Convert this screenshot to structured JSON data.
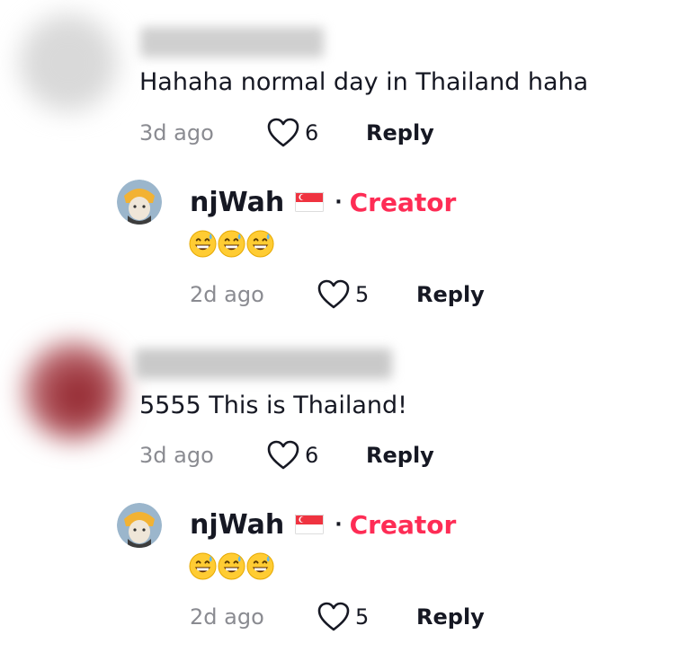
{
  "comments": [
    {
      "text": "Hahaha normal day in Thailand haha",
      "time": "3d ago",
      "likes": "6",
      "reply_label": "Reply",
      "reply": {
        "username": "njWah",
        "badge": "Creator",
        "separator": "·",
        "emoji_count": 3,
        "time": "2d ago",
        "likes": "5",
        "reply_label": "Reply"
      }
    },
    {
      "text": "5555 This is Thailand!",
      "time": "3d ago",
      "likes": "6",
      "reply_label": "Reply",
      "reply": {
        "username": "njWah",
        "badge": "Creator",
        "separator": "·",
        "emoji_count": 3,
        "time": "2d ago",
        "likes": "5",
        "reply_label": "Reply"
      }
    }
  ],
  "colors": {
    "creator": "#fe2c55",
    "muted": "#8a8b91",
    "text": "#161823"
  }
}
